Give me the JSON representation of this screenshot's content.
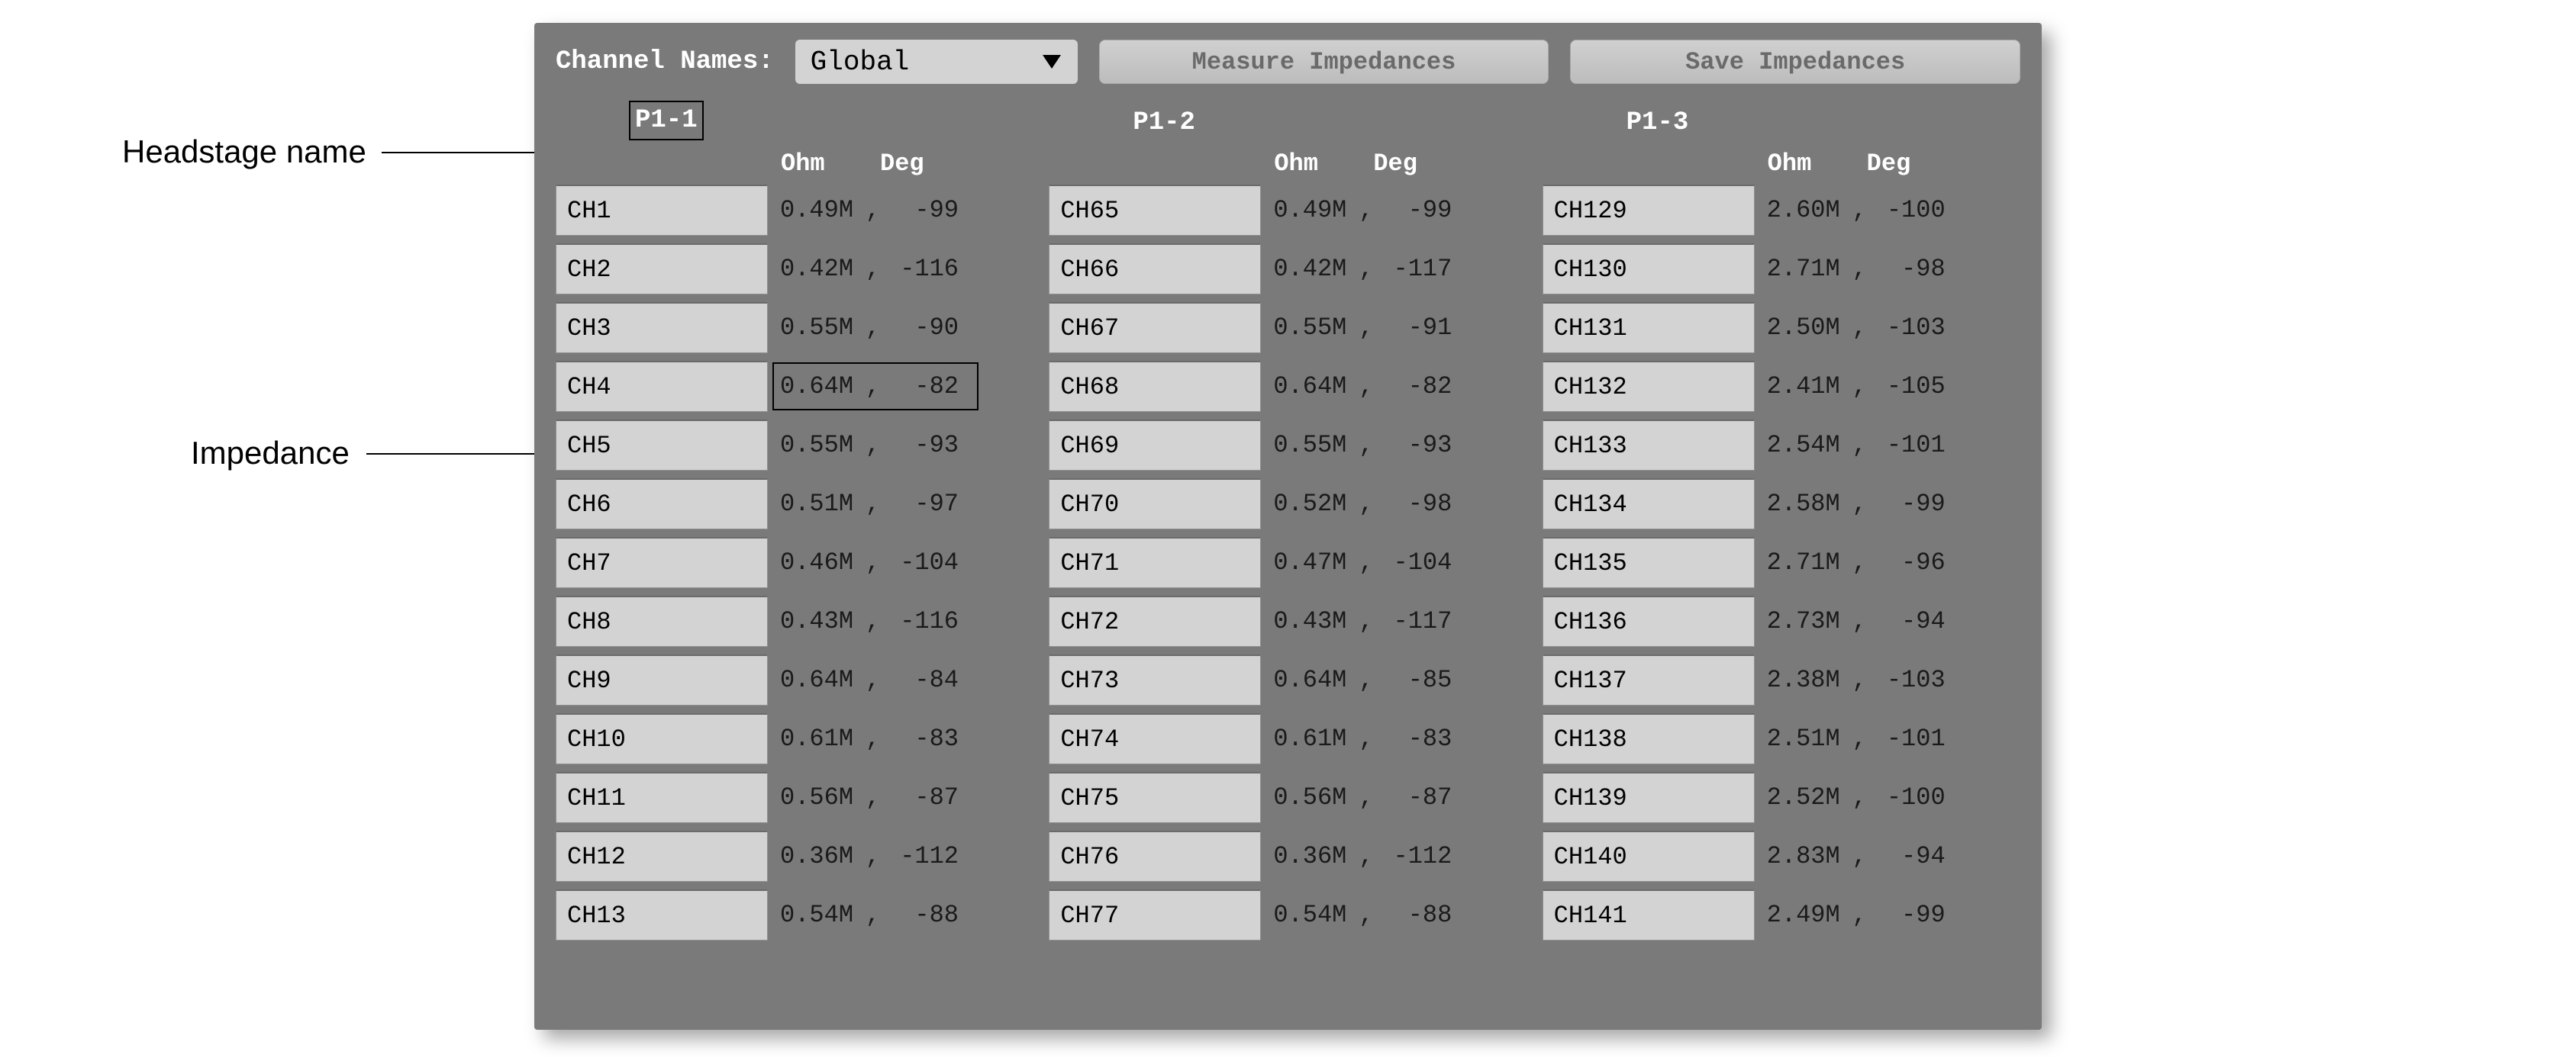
{
  "annotations": {
    "headstage": "Headstage name",
    "impedance": "Impedance"
  },
  "toolbar": {
    "label": "Channel Names:",
    "dropdown_value": "Global",
    "measure_btn": "Measure Impedances",
    "save_btn": "Save Impedances"
  },
  "columns": [
    {
      "title": "P1-1",
      "ohm_label": "Ohm",
      "deg_label": "Deg",
      "rows": [
        {
          "ch": "CH1",
          "ohm": "0.49M",
          "deg": "-99"
        },
        {
          "ch": "CH2",
          "ohm": "0.42M",
          "deg": "-116"
        },
        {
          "ch": "CH3",
          "ohm": "0.55M",
          "deg": "-90"
        },
        {
          "ch": "CH4",
          "ohm": "0.64M",
          "deg": "-82"
        },
        {
          "ch": "CH5",
          "ohm": "0.55M",
          "deg": "-93"
        },
        {
          "ch": "CH6",
          "ohm": "0.51M",
          "deg": "-97"
        },
        {
          "ch": "CH7",
          "ohm": "0.46M",
          "deg": "-104"
        },
        {
          "ch": "CH8",
          "ohm": "0.43M",
          "deg": "-116"
        },
        {
          "ch": "CH9",
          "ohm": "0.64M",
          "deg": "-84"
        },
        {
          "ch": "CH10",
          "ohm": "0.61M",
          "deg": "-83"
        },
        {
          "ch": "CH11",
          "ohm": "0.56M",
          "deg": "-87"
        },
        {
          "ch": "CH12",
          "ohm": "0.36M",
          "deg": "-112"
        },
        {
          "ch": "CH13",
          "ohm": "0.54M",
          "deg": "-88"
        }
      ]
    },
    {
      "title": "P1-2",
      "ohm_label": "Ohm",
      "deg_label": "Deg",
      "rows": [
        {
          "ch": "CH65",
          "ohm": "0.49M",
          "deg": "-99"
        },
        {
          "ch": "CH66",
          "ohm": "0.42M",
          "deg": "-117"
        },
        {
          "ch": "CH67",
          "ohm": "0.55M",
          "deg": "-91"
        },
        {
          "ch": "CH68",
          "ohm": "0.64M",
          "deg": "-82"
        },
        {
          "ch": "CH69",
          "ohm": "0.55M",
          "deg": "-93"
        },
        {
          "ch": "CH70",
          "ohm": "0.52M",
          "deg": "-98"
        },
        {
          "ch": "CH71",
          "ohm": "0.47M",
          "deg": "-104"
        },
        {
          "ch": "CH72",
          "ohm": "0.43M",
          "deg": "-117"
        },
        {
          "ch": "CH73",
          "ohm": "0.64M",
          "deg": "-85"
        },
        {
          "ch": "CH74",
          "ohm": "0.61M",
          "deg": "-83"
        },
        {
          "ch": "CH75",
          "ohm": "0.56M",
          "deg": "-87"
        },
        {
          "ch": "CH76",
          "ohm": "0.36M",
          "deg": "-112"
        },
        {
          "ch": "CH77",
          "ohm": "0.54M",
          "deg": "-88"
        }
      ]
    },
    {
      "title": "P1-3",
      "ohm_label": "Ohm",
      "deg_label": "Deg",
      "rows": [
        {
          "ch": "CH129",
          "ohm": "2.60M",
          "deg": "-100"
        },
        {
          "ch": "CH130",
          "ohm": "2.71M",
          "deg": "-98"
        },
        {
          "ch": "CH131",
          "ohm": "2.50M",
          "deg": "-103"
        },
        {
          "ch": "CH132",
          "ohm": "2.41M",
          "deg": "-105"
        },
        {
          "ch": "CH133",
          "ohm": "2.54M",
          "deg": "-101"
        },
        {
          "ch": "CH134",
          "ohm": "2.58M",
          "deg": "-99"
        },
        {
          "ch": "CH135",
          "ohm": "2.71M",
          "deg": "-96"
        },
        {
          "ch": "CH136",
          "ohm": "2.73M",
          "deg": "-94"
        },
        {
          "ch": "CH137",
          "ohm": "2.38M",
          "deg": "-103"
        },
        {
          "ch": "CH138",
          "ohm": "2.51M",
          "deg": "-101"
        },
        {
          "ch": "CH139",
          "ohm": "2.52M",
          "deg": "-100"
        },
        {
          "ch": "CH140",
          "ohm": "2.83M",
          "deg": "-94"
        },
        {
          "ch": "CH141",
          "ohm": "2.49M",
          "deg": "-99"
        }
      ]
    }
  ]
}
